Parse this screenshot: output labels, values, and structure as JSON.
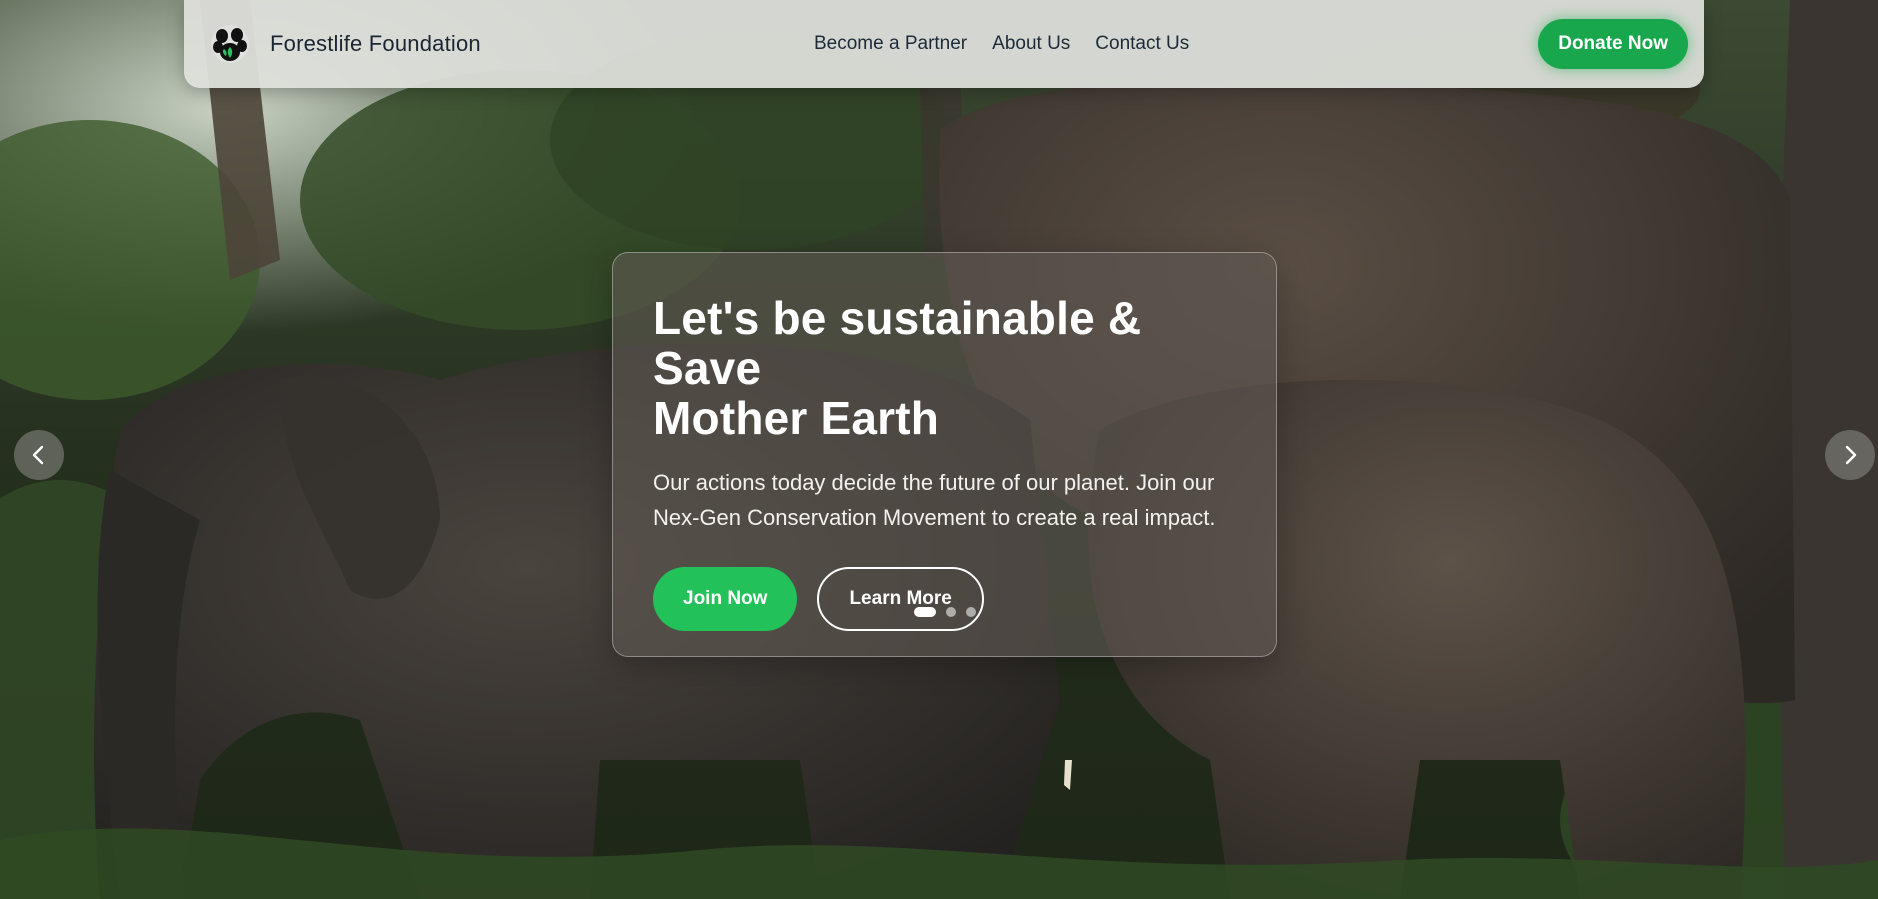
{
  "brand": {
    "name": "Forestlife Foundation",
    "logo_icon": "paw-leaf-logo-icon"
  },
  "nav": {
    "links": [
      "Become a Partner",
      "About Us",
      "Contact Us"
    ],
    "donate_label": "Donate Now"
  },
  "hero": {
    "title_line1": "Let's be sustainable & Save",
    "title_line2": "Mother Earth",
    "subtitle_line1": "Our actions today decide the future of our planet. Join our",
    "subtitle_line2": "Nex-Gen Conservation Movement to create a real impact.",
    "join_label": "Join Now",
    "learn_label": "Learn More"
  },
  "carousel": {
    "slide_count": 3,
    "active_slide": 1,
    "prev_icon": "chevron-left-icon",
    "next_icon": "chevron-right-icon"
  },
  "colors": {
    "accent": "#18a74c",
    "join_button": "#22c15a",
    "navbar_bg": "#dee0db",
    "text_dark": "#1c2533"
  }
}
